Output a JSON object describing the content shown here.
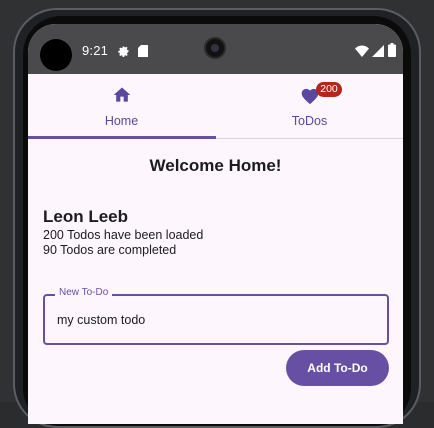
{
  "status_bar": {
    "time": "9:21",
    "icons": [
      "settings-gear-icon",
      "sd-card-icon",
      "wifi-icon",
      "signal-icon",
      "battery-icon"
    ]
  },
  "tabs": [
    {
      "label": "Home",
      "icon": "home-icon",
      "selected": true
    },
    {
      "label": "ToDos",
      "icon": "heart-icon",
      "badge": "200",
      "selected": false
    }
  ],
  "home": {
    "title": "Welcome Home!",
    "user_name": "Leon Leeb",
    "loaded_text": "200 Todos have been loaded",
    "completed_text": "90 Todos are completed"
  },
  "new_todo": {
    "label": "New To-Do",
    "value": "my custom todo"
  },
  "add_button": {
    "label": "Add To-Do"
  },
  "colors": {
    "primary": "#6750a4",
    "badge": "#b3261e",
    "background": "#fdf7fd"
  }
}
